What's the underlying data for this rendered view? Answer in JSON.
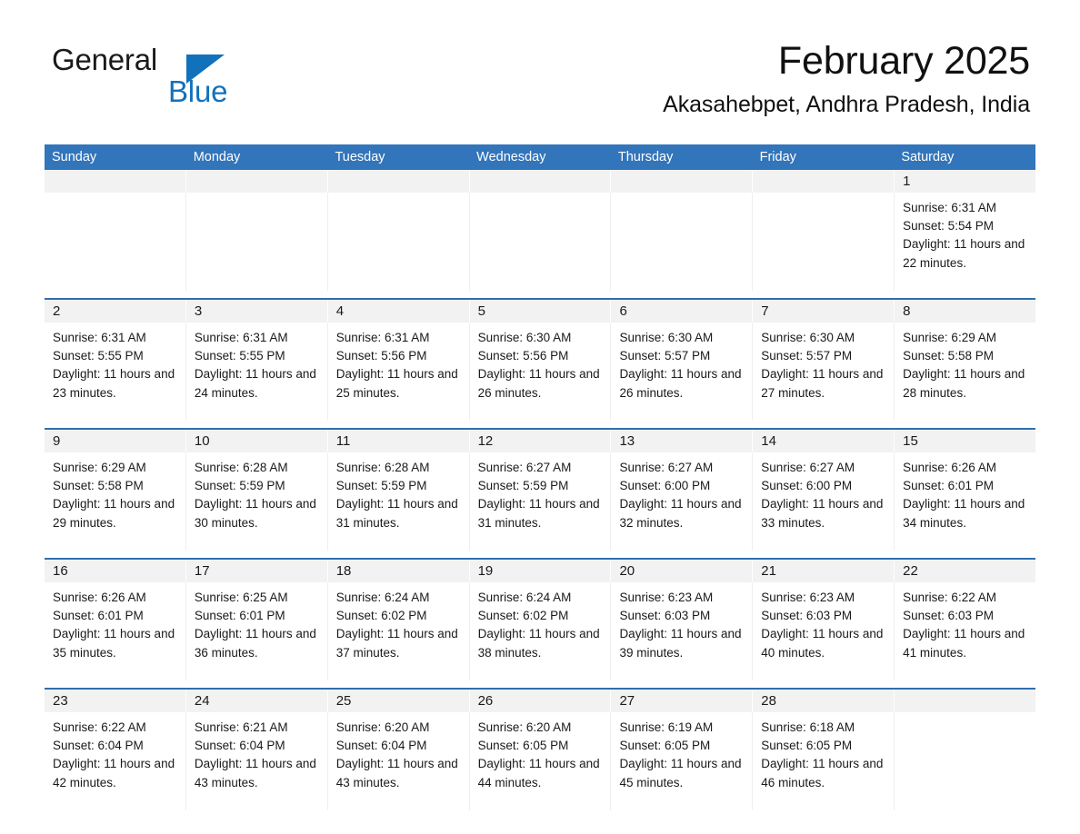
{
  "brand": {
    "name_part1": "General",
    "name_part2": "Blue",
    "triangle_color": "#1271bb"
  },
  "header": {
    "title": "February 2025",
    "subtitle": "Akasahebpet, Andhra Pradesh, India"
  },
  "theme": {
    "header_blue": "#3275ba",
    "row_rule_blue": "#2f6fae",
    "daynum_band": "#f2f2f2",
    "text": "#1a1a1a"
  },
  "weekdays": [
    "Sunday",
    "Monday",
    "Tuesday",
    "Wednesday",
    "Thursday",
    "Friday",
    "Saturday"
  ],
  "weeks": [
    [
      {
        "day": "",
        "empty": true
      },
      {
        "day": "",
        "empty": true
      },
      {
        "day": "",
        "empty": true
      },
      {
        "day": "",
        "empty": true
      },
      {
        "day": "",
        "empty": true
      },
      {
        "day": "",
        "empty": true
      },
      {
        "day": "1",
        "sunrise": "Sunrise: 6:31 AM",
        "sunset": "Sunset: 5:54 PM",
        "daylight": "Daylight: 11 hours and 22 minutes."
      }
    ],
    [
      {
        "day": "2",
        "sunrise": "Sunrise: 6:31 AM",
        "sunset": "Sunset: 5:55 PM",
        "daylight": "Daylight: 11 hours and 23 minutes."
      },
      {
        "day": "3",
        "sunrise": "Sunrise: 6:31 AM",
        "sunset": "Sunset: 5:55 PM",
        "daylight": "Daylight: 11 hours and 24 minutes."
      },
      {
        "day": "4",
        "sunrise": "Sunrise: 6:31 AM",
        "sunset": "Sunset: 5:56 PM",
        "daylight": "Daylight: 11 hours and 25 minutes."
      },
      {
        "day": "5",
        "sunrise": "Sunrise: 6:30 AM",
        "sunset": "Sunset: 5:56 PM",
        "daylight": "Daylight: 11 hours and 26 minutes."
      },
      {
        "day": "6",
        "sunrise": "Sunrise: 6:30 AM",
        "sunset": "Sunset: 5:57 PM",
        "daylight": "Daylight: 11 hours and 26 minutes."
      },
      {
        "day": "7",
        "sunrise": "Sunrise: 6:30 AM",
        "sunset": "Sunset: 5:57 PM",
        "daylight": "Daylight: 11 hours and 27 minutes."
      },
      {
        "day": "8",
        "sunrise": "Sunrise: 6:29 AM",
        "sunset": "Sunset: 5:58 PM",
        "daylight": "Daylight: 11 hours and 28 minutes."
      }
    ],
    [
      {
        "day": "9",
        "sunrise": "Sunrise: 6:29 AM",
        "sunset": "Sunset: 5:58 PM",
        "daylight": "Daylight: 11 hours and 29 minutes."
      },
      {
        "day": "10",
        "sunrise": "Sunrise: 6:28 AM",
        "sunset": "Sunset: 5:59 PM",
        "daylight": "Daylight: 11 hours and 30 minutes."
      },
      {
        "day": "11",
        "sunrise": "Sunrise: 6:28 AM",
        "sunset": "Sunset: 5:59 PM",
        "daylight": "Daylight: 11 hours and 31 minutes."
      },
      {
        "day": "12",
        "sunrise": "Sunrise: 6:27 AM",
        "sunset": "Sunset: 5:59 PM",
        "daylight": "Daylight: 11 hours and 31 minutes."
      },
      {
        "day": "13",
        "sunrise": "Sunrise: 6:27 AM",
        "sunset": "Sunset: 6:00 PM",
        "daylight": "Daylight: 11 hours and 32 minutes."
      },
      {
        "day": "14",
        "sunrise": "Sunrise: 6:27 AM",
        "sunset": "Sunset: 6:00 PM",
        "daylight": "Daylight: 11 hours and 33 minutes."
      },
      {
        "day": "15",
        "sunrise": "Sunrise: 6:26 AM",
        "sunset": "Sunset: 6:01 PM",
        "daylight": "Daylight: 11 hours and 34 minutes."
      }
    ],
    [
      {
        "day": "16",
        "sunrise": "Sunrise: 6:26 AM",
        "sunset": "Sunset: 6:01 PM",
        "daylight": "Daylight: 11 hours and 35 minutes."
      },
      {
        "day": "17",
        "sunrise": "Sunrise: 6:25 AM",
        "sunset": "Sunset: 6:01 PM",
        "daylight": "Daylight: 11 hours and 36 minutes."
      },
      {
        "day": "18",
        "sunrise": "Sunrise: 6:24 AM",
        "sunset": "Sunset: 6:02 PM",
        "daylight": "Daylight: 11 hours and 37 minutes."
      },
      {
        "day": "19",
        "sunrise": "Sunrise: 6:24 AM",
        "sunset": "Sunset: 6:02 PM",
        "daylight": "Daylight: 11 hours and 38 minutes."
      },
      {
        "day": "20",
        "sunrise": "Sunrise: 6:23 AM",
        "sunset": "Sunset: 6:03 PM",
        "daylight": "Daylight: 11 hours and 39 minutes."
      },
      {
        "day": "21",
        "sunrise": "Sunrise: 6:23 AM",
        "sunset": "Sunset: 6:03 PM",
        "daylight": "Daylight: 11 hours and 40 minutes."
      },
      {
        "day": "22",
        "sunrise": "Sunrise: 6:22 AM",
        "sunset": "Sunset: 6:03 PM",
        "daylight": "Daylight: 11 hours and 41 minutes."
      }
    ],
    [
      {
        "day": "23",
        "sunrise": "Sunrise: 6:22 AM",
        "sunset": "Sunset: 6:04 PM",
        "daylight": "Daylight: 11 hours and 42 minutes."
      },
      {
        "day": "24",
        "sunrise": "Sunrise: 6:21 AM",
        "sunset": "Sunset: 6:04 PM",
        "daylight": "Daylight: 11 hours and 43 minutes."
      },
      {
        "day": "25",
        "sunrise": "Sunrise: 6:20 AM",
        "sunset": "Sunset: 6:04 PM",
        "daylight": "Daylight: 11 hours and 43 minutes."
      },
      {
        "day": "26",
        "sunrise": "Sunrise: 6:20 AM",
        "sunset": "Sunset: 6:05 PM",
        "daylight": "Daylight: 11 hours and 44 minutes."
      },
      {
        "day": "27",
        "sunrise": "Sunrise: 6:19 AM",
        "sunset": "Sunset: 6:05 PM",
        "daylight": "Daylight: 11 hours and 45 minutes."
      },
      {
        "day": "28",
        "sunrise": "Sunrise: 6:18 AM",
        "sunset": "Sunset: 6:05 PM",
        "daylight": "Daylight: 11 hours and 46 minutes."
      },
      {
        "day": "",
        "empty": true
      }
    ]
  ]
}
